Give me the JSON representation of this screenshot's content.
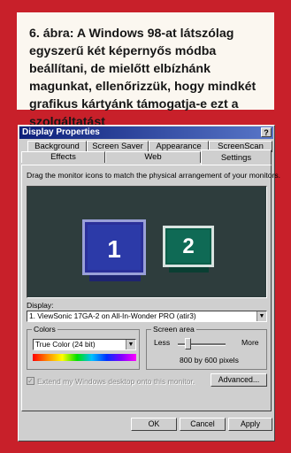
{
  "caption": {
    "text": "6. ábra: A Windows 98-at látszólag egyszerű két képernyős módba beállítani, de mielőtt elbízhánk magunkat, ellenőrizzük, hogy mindkét grafikus kártyánk támogatja-e ezt a szolgáltatást"
  },
  "dialog": {
    "title": "Display Properties",
    "help_label": "?",
    "tabs_back": [
      "Background",
      "Screen Saver",
      "Appearance",
      "ScreenScan"
    ],
    "tabs_front": [
      "Effects",
      "Web",
      "Settings"
    ],
    "instruction": "Drag the monitor icons to match the physical arrangement of your monitors.",
    "monitors": [
      "1",
      "2"
    ],
    "display_label": "Display:",
    "display_value": "1. ViewSonic 17GA-2 on All-In-Wonder PRO (atir3)",
    "colors_label": "Colors",
    "colors_value": "True Color (24 bit)",
    "screen_area_label": "Screen area",
    "less_label": "Less",
    "more_label": "More",
    "resolution": "800 by 600 pixels",
    "extend_label": "Extend my Windows desktop onto this monitor.",
    "advanced_label": "Advanced...",
    "ok_label": "OK",
    "cancel_label": "Cancel",
    "apply_label": "Apply"
  }
}
